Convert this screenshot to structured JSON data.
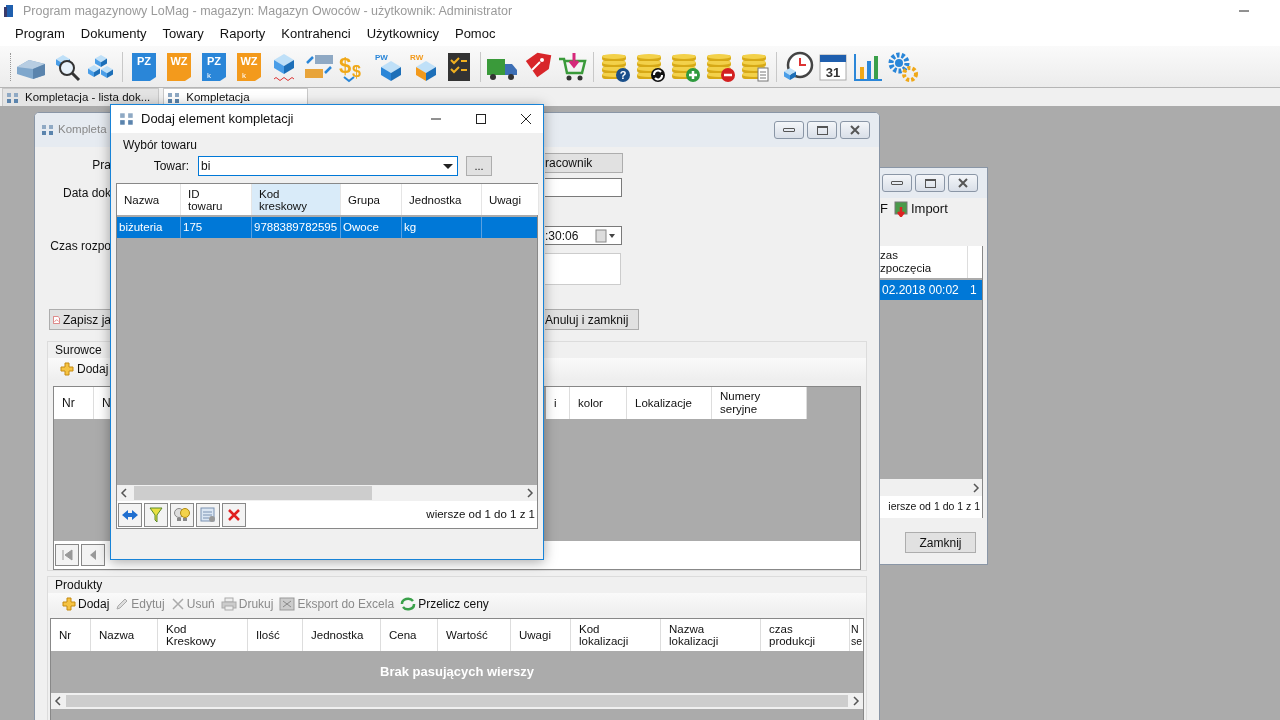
{
  "app_title": "Program magazynowy LoMag - magazyn: Magazyn Owoców - użytkownik: Administrator",
  "menu": [
    "Program",
    "Dokumenty",
    "Towary",
    "Raporty",
    "Kontrahenci",
    "Użytkownicy",
    "Pomoc"
  ],
  "toolbar": [
    {
      "kind": "warehouse"
    },
    {
      "kind": "search"
    },
    {
      "kind": "boxes"
    },
    {
      "kind": "sep"
    },
    {
      "kind": "doc",
      "label": "PZ",
      "color": "#2a86d8"
    },
    {
      "kind": "doc",
      "label": "WZ",
      "color": "#f39a1c"
    },
    {
      "kind": "doc",
      "label": "PZ",
      "sub": "k",
      "color": "#2a86d8"
    },
    {
      "kind": "doc",
      "label": "WZ",
      "sub": "k",
      "color": "#f39a1c"
    },
    {
      "kind": "box"
    },
    {
      "kind": "transfer"
    },
    {
      "kind": "money",
      "labels": [
        "$",
        "$"
      ]
    },
    {
      "kind": "labeled_box",
      "label": "PW",
      "color": "#2a86d8"
    },
    {
      "kind": "labeled_box",
      "label": "RW",
      "color": "#f39a1c"
    },
    {
      "kind": "checklist"
    },
    {
      "kind": "sep"
    },
    {
      "kind": "truck"
    },
    {
      "kind": "tag"
    },
    {
      "kind": "cart"
    },
    {
      "kind": "sep"
    },
    {
      "kind": "coins_question",
      "label": "?"
    },
    {
      "kind": "coins_refresh"
    },
    {
      "kind": "coins_plus"
    },
    {
      "kind": "coins_minus"
    },
    {
      "kind": "coins_doc"
    },
    {
      "kind": "sep"
    },
    {
      "kind": "clock"
    },
    {
      "kind": "calendar",
      "label": "31"
    },
    {
      "kind": "chart"
    },
    {
      "kind": "gears"
    }
  ],
  "tabs": [
    {
      "label": "Kompletacja - lista dok...",
      "selected": false
    },
    {
      "label": "Kompletacja",
      "selected": true
    }
  ],
  "list_window": {
    "toolbar_text": "F",
    "import_button": "Import",
    "column_header": "zas\nzpoczęcia",
    "rows": [
      {
        "cells": [
          "02.2018 00:02",
          "1"
        ],
        "selected": true
      }
    ],
    "footer": "iersze od 1 do 1 z 1",
    "close_button": "Zamknij"
  },
  "doc_window": {
    "title": "Kompleta",
    "labels": [
      "Pra",
      "Data dok",
      "Czas rozpo"
    ],
    "employee_button": "racownik",
    "time_value": ":30:06",
    "save_button": "Zapisz ja",
    "cancel_button": "Anuluj i zamknij",
    "raw_materials": {
      "title": "Surowce",
      "add_button": "Dodaj",
      "left_columns": [
        "Nr",
        "N"
      ],
      "right_columns": [
        "i",
        "kolor",
        "Lokalizacje",
        "Numery\nseryjne"
      ]
    },
    "products": {
      "title": "Produkty",
      "toolbar": [
        {
          "label": "Dodaj",
          "kind": "add",
          "disabled": false
        },
        {
          "label": "Edytuj",
          "kind": "edit",
          "disabled": true
        },
        {
          "label": "Usuń",
          "kind": "delete",
          "disabled": true
        },
        {
          "label": "Drukuj",
          "kind": "print",
          "disabled": true
        },
        {
          "label": "Eksport do Excela",
          "kind": "excel",
          "disabled": true
        },
        {
          "label": "Przelicz ceny",
          "kind": "recalc",
          "disabled": false
        }
      ],
      "columns": [
        "Nr",
        "Nazwa",
        "Kod\nKreskowy",
        "Ilość",
        "Jednostka",
        "Cena",
        "Wartość",
        "Uwagi",
        "Kod\nlokalizacji",
        "Nazwa\nlokalizacji",
        "czas\nprodukcji",
        "N\nse"
      ],
      "empty_text": "Brak pasujących wierszy"
    }
  },
  "dialog": {
    "title": "Dodaj element kompletacji",
    "group": "Wybór towaru",
    "field_label": "Towar:",
    "field_value": "bi",
    "browse_button": "...",
    "columns": [
      {
        "label": "Nazwa",
        "hovered": false
      },
      {
        "label": "ID\ntowaru",
        "hovered": false
      },
      {
        "label": "Kod\nkreskowy",
        "hovered": true
      },
      {
        "label": "Grupa",
        "hovered": false
      },
      {
        "label": "Jednostka",
        "hovered": false
      },
      {
        "label": "Uwagi",
        "hovered": false
      }
    ],
    "rows": [
      {
        "cells": [
          "biżuteria",
          "175",
          "9788389782595",
          "Owoce",
          "kg"
        ],
        "selected": true
      }
    ],
    "footer_buttons": [
      {
        "kind": "resize"
      },
      {
        "kind": "filter"
      },
      {
        "kind": "bulbs"
      },
      {
        "kind": "settings"
      },
      {
        "kind": "delete"
      }
    ],
    "footer": "wiersze od 1 do 1 z 1"
  }
}
